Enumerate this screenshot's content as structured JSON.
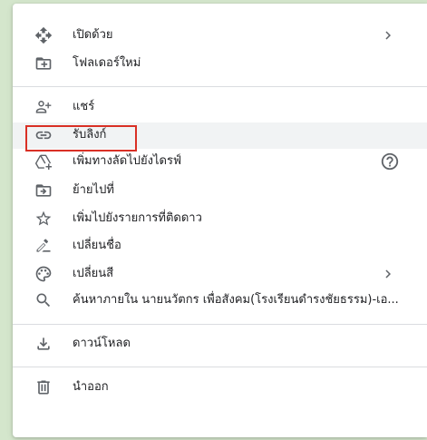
{
  "menu": {
    "open_with": {
      "label": "เปิดด้วย",
      "icon": "open-with-icon",
      "submenu": true
    },
    "new_folder": {
      "label": "โฟลเดอร์ใหม่",
      "icon": "new-folder-icon"
    },
    "share": {
      "label": "แชร์",
      "icon": "person-add-icon"
    },
    "get_link": {
      "label": "รับลิงก์",
      "icon": "link-icon"
    },
    "add_shortcut": {
      "label": "เพิ่มทางลัดไปยังไดรฟ์",
      "icon": "add-to-drive-icon",
      "help_icon": "help-circle-icon"
    },
    "move_to": {
      "label": "ย้ายไปที่",
      "icon": "move-to-folder-icon"
    },
    "add_starred": {
      "label": "เพิ่มไปยังรายการที่ติดดาว",
      "icon": "star-outline-icon"
    },
    "rename": {
      "label": "เปลี่ยนชื่อ",
      "icon": "edit-icon"
    },
    "change_color": {
      "label": "เปลี่ยนสี",
      "icon": "palette-icon",
      "submenu": true
    },
    "search_within": {
      "label": "ค้นหาภายใน นายนวัตกร เพื่อสังคม(โรงเรียนดำรงชัยธรรม)-เอ...",
      "icon": "search-icon"
    },
    "download": {
      "label": "ดาวน์โหลด",
      "icon": "download-icon"
    },
    "remove": {
      "label": "นำออก",
      "icon": "trash-icon"
    }
  },
  "colors": {
    "highlight_bg": "#f1f3f4",
    "focus_outline": "#d93025",
    "icon": "#5f6368",
    "divider": "#dadce0"
  }
}
